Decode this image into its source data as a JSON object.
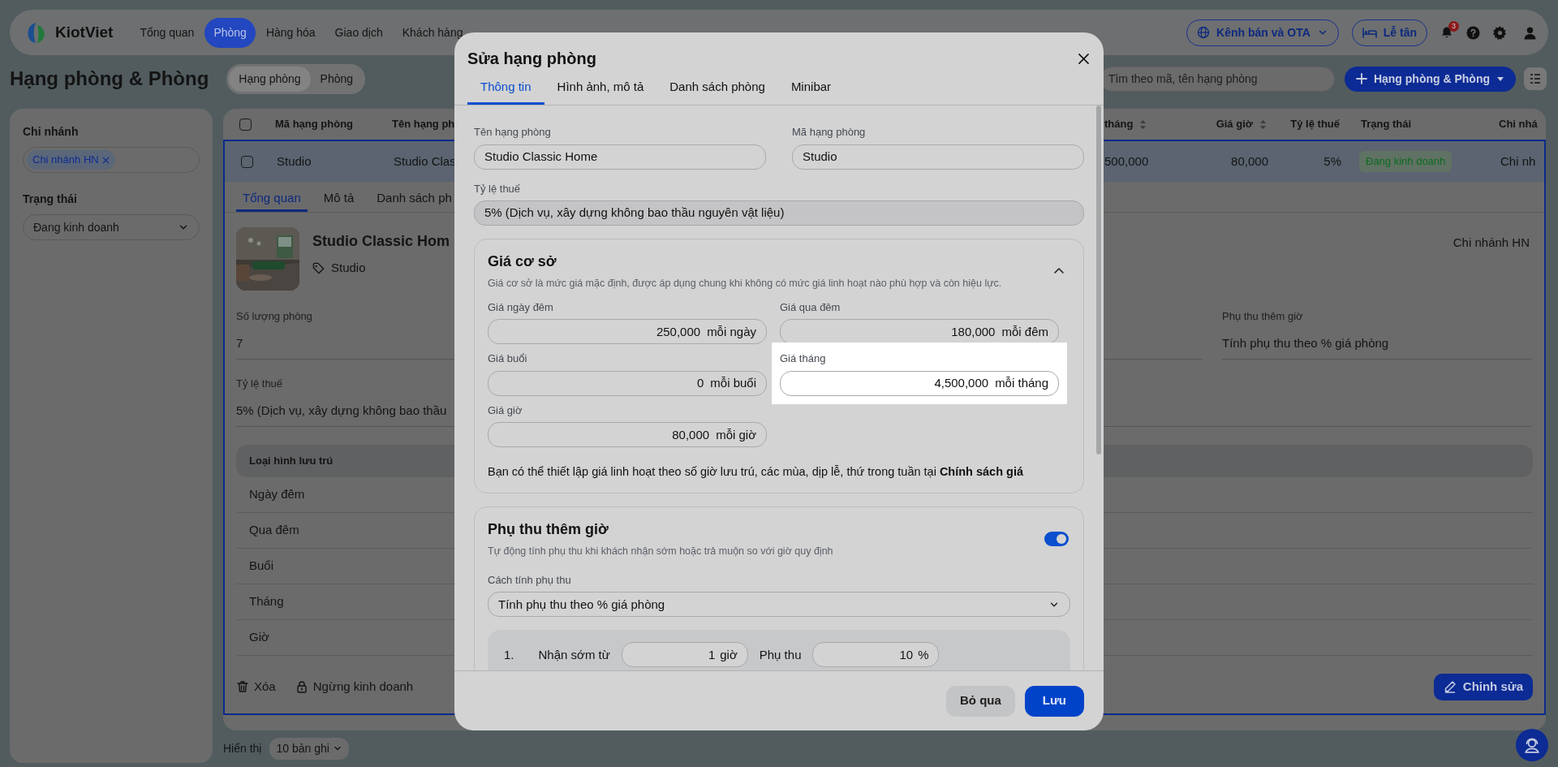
{
  "top_nav": {
    "brand": "KiotViet",
    "items": [
      {
        "label": "Tổng quan",
        "selected": false
      },
      {
        "label": "Phòng",
        "selected": true
      },
      {
        "label": "Hàng hóa",
        "selected": false
      },
      {
        "label": "Giao dịch",
        "selected": false
      },
      {
        "label": "Khách hàng",
        "selected": false
      }
    ],
    "channel_button": "Kênh bán và OTA",
    "reception_button": "Lễ tân",
    "notification_count": "3"
  },
  "page": {
    "title": "Hạng phòng & Phòng",
    "view_tabs": [
      {
        "label": "Hạng phòng",
        "selected": true
      },
      {
        "label": "Phòng",
        "selected": false
      }
    ],
    "search": {
      "placeholder": "Tìm theo mã, tên hạng phòng"
    },
    "add_button": "Hạng phòng & Phòng"
  },
  "filters": [
    {
      "label": "Chi nhánh",
      "kind": "tags",
      "tags": [
        "Chi nhánh HN"
      ]
    },
    {
      "label": "Trạng thái",
      "kind": "select",
      "value": "Đang kinh doanh"
    }
  ],
  "table": {
    "all_checked": false,
    "columns": [
      {
        "label": "Mã hạng phòng",
        "kind": "text",
        "sortable": false
      },
      {
        "label": "Tên hạng ph",
        "kind": "text",
        "sortable": false
      },
      {
        "label": "tháng",
        "kind": "text",
        "sortable": true
      },
      {
        "label": "Giá giờ",
        "kind": "number",
        "sortable": true
      },
      {
        "label": "Tỷ lệ thuế",
        "kind": "number",
        "sortable": false
      },
      {
        "label": "Trạng thái",
        "kind": "badge",
        "sortable": false
      },
      {
        "label": "Chi nhá",
        "kind": "text",
        "sortable": false
      }
    ],
    "rows": [
      {
        "checked": false,
        "selected": true,
        "expanded": true,
        "cells": [
          "Studio",
          "Studio Clas",
          "500,000",
          "80,000",
          "5%",
          "Đang kinh doanh",
          "Chi nh"
        ]
      }
    ]
  },
  "detail": {
    "tabs": [
      {
        "label": "Tổng quan",
        "selected": true
      },
      {
        "label": "Mô tả",
        "selected": false
      },
      {
        "label": "Danh sách ph",
        "selected": false
      }
    ],
    "name": "Studio Classic Hom",
    "tag": "Studio",
    "branch": "Chi nhánh HN",
    "fields": [
      {
        "label": "Số lượng phòng",
        "value": "7"
      },
      {
        "label": "Phụ thu thêm giờ",
        "value": "Tính phụ thu theo % giá phòng"
      },
      {
        "label": "Tỷ lệ thuế",
        "value": "5% (Dịch vụ, xây dựng không bao thầu"
      }
    ],
    "stay_header": "Loại hình lưu trú",
    "stay_types": [
      "Ngày đêm",
      "Qua đêm",
      "Buổi",
      "Tháng",
      "Giờ"
    ],
    "actions": [
      {
        "label": "Xóa",
        "kind": "delete"
      },
      {
        "label": "Ngừng kinh doanh",
        "kind": "lock"
      }
    ],
    "edit_button": "Chỉnh sửa"
  },
  "pagination": {
    "label": "Hiển thị",
    "page_size": "10 bản ghi"
  },
  "modal": {
    "title": "Sửa hạng phòng",
    "tabs": [
      {
        "label": "Thông tin",
        "selected": true
      },
      {
        "label": "Hình ảnh, mô tả",
        "selected": false
      },
      {
        "label": "Danh sách phòng",
        "selected": false
      },
      {
        "label": "Minibar",
        "selected": false
      }
    ],
    "fields": [
      {
        "label": "Tên hạng phòng",
        "value": "Studio Classic Home",
        "disabled": false
      },
      {
        "label": "Mã hạng phòng",
        "value": "Studio",
        "disabled": false
      },
      {
        "label": "Tỷ lệ thuế",
        "value": "5% (Dịch vụ, xây dựng không bao thầu nguyên vật liệu)",
        "disabled": true
      }
    ],
    "base_price": {
      "title": "Giá cơ sở",
      "description": "Giá cơ sở là mức giá mặc định, được áp dụng chung khi không có mức giá linh hoạt nào phù hợp và còn hiệu lực.",
      "expanded": true,
      "prices": [
        {
          "label": "Giá ngày đêm",
          "value": "250,000",
          "unit": "mỗi ngày",
          "highlighted": false
        },
        {
          "label": "Giá qua đêm",
          "value": "180,000",
          "unit": "mỗi đêm",
          "highlighted": false
        },
        {
          "label": "Giá buổi",
          "value": "0",
          "unit": "mỗi buổi",
          "highlighted": false
        },
        {
          "label": "Giá tháng",
          "value": "4,500,000",
          "unit": "mỗi tháng",
          "highlighted": true
        },
        {
          "label": "Giá giờ",
          "value": "80,000",
          "unit": "mỗi giờ",
          "highlighted": false
        }
      ],
      "note": "Bạn có thể thiết lập giá linh hoạt theo số giờ lưu trú, các mùa, dịp lễ, thứ trong tuần tại **Chính sách giá**"
    },
    "surcharge": {
      "title": "Phụ thu thêm giờ",
      "description": "Tự động tính phụ thu khi khách nhận sớm hoặc trả muộn so với giờ quy định",
      "on": true,
      "method_label": "Cách tính phụ thu",
      "method": "Tính phụ thu theo % giá phòng",
      "rules": [
        {
          "number": "1.",
          "label": "Nhận sớm từ",
          "hours": "1",
          "hours_unit": "giờ",
          "surcharge_label": "Phụ thu",
          "percent": "10",
          "percent_unit": "%"
        }
      ]
    },
    "buttons": [
      {
        "label": "Bỏ qua",
        "kind": "secondary"
      },
      {
        "label": "Lưu",
        "kind": "primary"
      }
    ]
  }
}
